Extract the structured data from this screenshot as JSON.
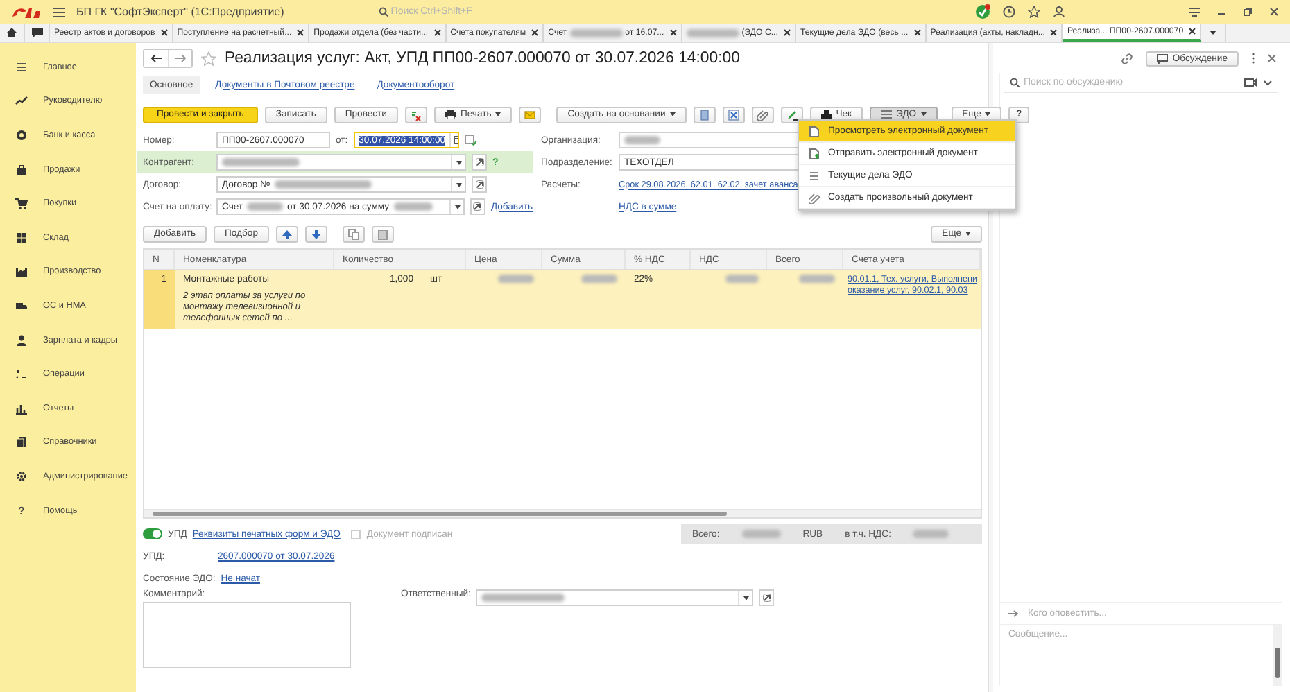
{
  "app_bar": {
    "title": "БП ГК \"СофтЭксперт\" (1С:Предприятие)",
    "search_placeholder": "Поиск Ctrl+Shift+F"
  },
  "tabs": [
    {
      "label": "Реестр актов и договоров",
      "selected": false,
      "redacted": false
    },
    {
      "label": "Поступление на расчетный...",
      "selected": false,
      "redacted": false
    },
    {
      "label": "Продажи отдела (без части...",
      "selected": false,
      "redacted": false
    },
    {
      "label": "Счета покупателям",
      "selected": false,
      "redacted": false
    },
    {
      "label": "Счет",
      "suffix": "от 16.07...",
      "selected": false,
      "redacted": true
    },
    {
      "suffix": "(ЭДО С...",
      "selected": false,
      "redacted": true
    },
    {
      "label": "Текущие дела ЭДО (весь ...",
      "selected": false,
      "redacted": false
    },
    {
      "label": "Реализация (акты, накладн...",
      "selected": false,
      "redacted": false
    },
    {
      "label": "Реализа... ПП00-2607.000070",
      "selected": true,
      "redacted": false
    }
  ],
  "sidebar": {
    "items": [
      {
        "label": "Главное",
        "selected": false
      },
      {
        "label": "Руководителю",
        "selected": false
      },
      {
        "label": "Банк и касса",
        "selected": false
      },
      {
        "label": "Продажи",
        "selected": false
      },
      {
        "label": "Покупки",
        "selected": false
      },
      {
        "label": "Склад",
        "selected": false
      },
      {
        "label": "Производство",
        "selected": false
      },
      {
        "label": "ОС и НМА",
        "selected": false
      },
      {
        "label": "Зарплата и кадры",
        "selected": false
      },
      {
        "label": "Операции",
        "selected": false
      },
      {
        "label": "Отчеты",
        "selected": false
      },
      {
        "label": "Справочники",
        "selected": false
      },
      {
        "label": "Администрирование",
        "selected": false
      },
      {
        "label": "Помощь",
        "selected": false,
        "glyph": "?"
      }
    ]
  },
  "document": {
    "title": "Реализация услуг: Акт, УПД ПП00-2607.000070 от 30.07.2026 14:00:00",
    "favorite": false,
    "sections": [
      {
        "label": "Основное",
        "selected": true
      },
      {
        "label": "Документы в Почтовом реестре",
        "selected": false
      },
      {
        "label": "Документооборот",
        "selected": false
      }
    ],
    "toolbar": {
      "post_close": "Провести и закрыть",
      "save": "Записать",
      "post": "Провести",
      "print": "Печать",
      "create_based": "Создать на основании",
      "receipt": "Чек",
      "edo": "ЭДО",
      "more": "Еще",
      "help": "?"
    },
    "fields": {
      "number_label": "Номер:",
      "number": "ПП00-2607.000070",
      "date_label": "от:",
      "date": "30.07.2026 14:00:00",
      "counterparty_label": "Контрагент:",
      "counterparty_redacted": true,
      "counterparty_help": "?",
      "contract_label": "Договор:",
      "contract": "Договор №",
      "contract_redacted": true,
      "invoice_label": "Счет на оплату:",
      "invoice_prefix": "Счет",
      "invoice_middle": "от 30.07.2026 на сумму",
      "invoice_redacted": true,
      "invoice_add": "Добавить",
      "organization_label": "Организация:",
      "organization_redacted": true,
      "department_label": "Подразделение:",
      "department": "ТЕХОТДЕЛ",
      "settlements_label": "Расчеты:",
      "settlements": "Срок 29.08.2026, 62.01, 62.02, зачет аванса",
      "vat": "НДС в сумме"
    },
    "table_toolbar": {
      "add": "Добавить",
      "pick": "Подбор",
      "more": "Еще"
    },
    "table": {
      "columns": [
        "N",
        "Номенклатура",
        "Количество",
        "Цена",
        "Сумма",
        "% НДС",
        "НДС",
        "Всего",
        "Счета учета"
      ],
      "rows": [
        {
          "n": "1",
          "item": "Монтажные работы",
          "content": "2 этап оплаты за услуги по монтажу телевизионной и телефонных сетей по ...",
          "quantity": "1,000",
          "unit": "шт",
          "price_redacted": true,
          "sum_redacted": true,
          "vat_rate": "22%",
          "vat_redacted": true,
          "total_redacted": true,
          "accounts": "90.01.1, Тех. услуги, Выполнени",
          "accounts_2": "оказание услуг, 90.02.1, 90.03",
          "selected": true
        }
      ]
    },
    "footer": {
      "upd_on": true,
      "upd_label": "УПД",
      "print_link": "Реквизиты печатных форм и ЭДО",
      "signed": false,
      "signed_label": "Документ подписан",
      "total_label": "Всего:",
      "total_redacted": true,
      "currency": "RUB",
      "vat_label": "в т.ч. НДС:",
      "vat_redacted": true,
      "upd_field_label": "УПД:",
      "upd_link": "2607.000070 от 30.07.2026",
      "edo_state_label": "Состояние ЭДО:",
      "edo_state": "Не начат",
      "comment_label": "Комментарий:",
      "responsible_label": "Ответственный:",
      "responsible_redacted": true
    }
  },
  "edo_menu": {
    "items": [
      {
        "label": "Просмотреть электронный документ",
        "selected": true
      },
      {
        "label": "Отправить электронный документ",
        "selected": false
      },
      {
        "label": "Текущие дела ЭДО",
        "selected": false
      },
      {
        "label": "Создать произвольный документ",
        "selected": false
      }
    ]
  },
  "discussion": {
    "button": "Обсуждение",
    "search_placeholder": "Поиск по обсуждению",
    "recipients_placeholder": "Кого оповестить...",
    "message_placeholder": "Сообщение..."
  }
}
